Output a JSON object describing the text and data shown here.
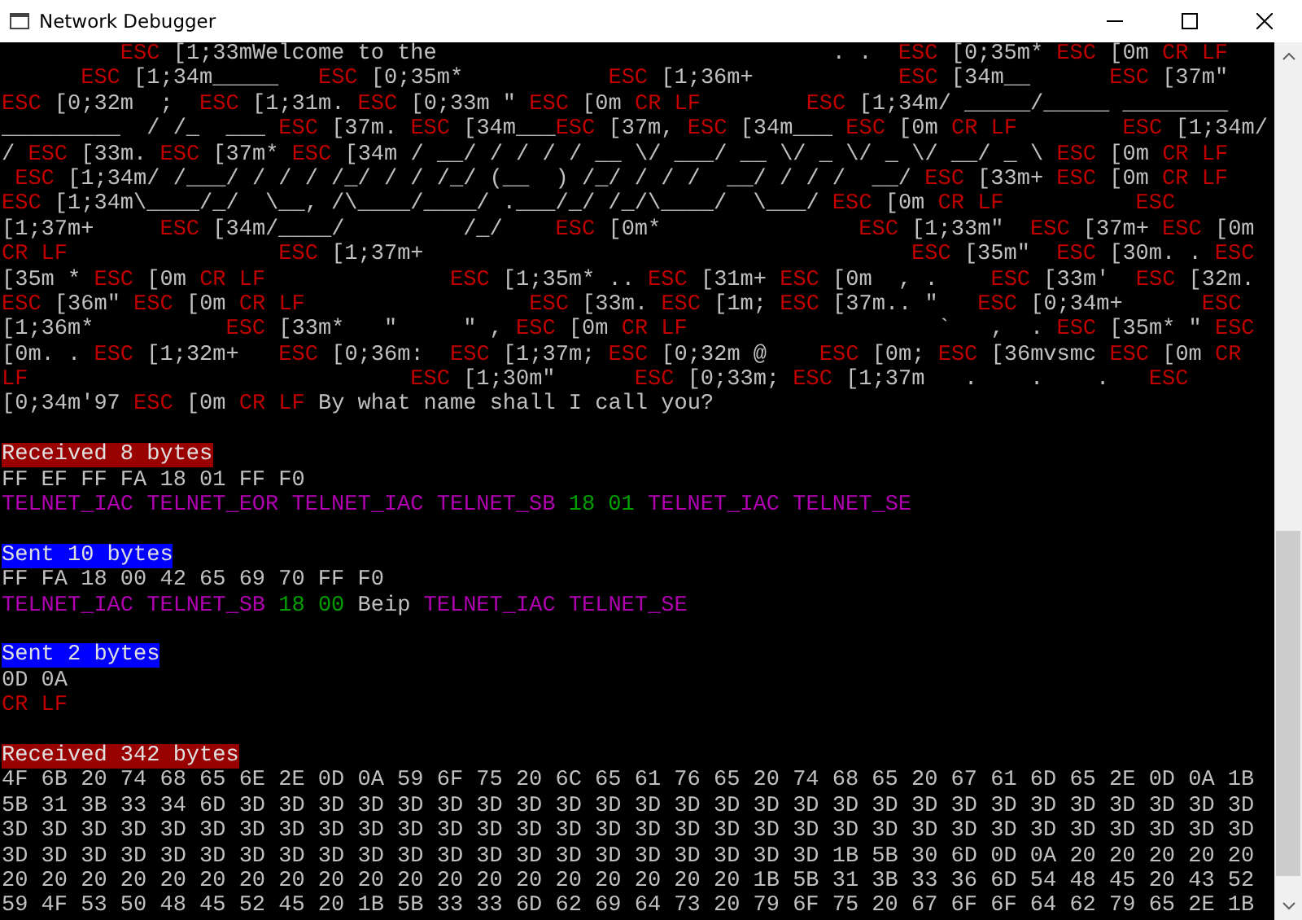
{
  "window": {
    "title": "Network Debugger"
  },
  "console": {
    "lines": [
      {
        "kind": "segments",
        "segments": [
          {
            "kind": "control",
            "text": "         ESC"
          },
          {
            "kind": "text",
            "text": " [1;33mWelcome to the                              . .  "
          },
          {
            "kind": "control",
            "text": "ESC"
          },
          {
            "kind": "text",
            "text": " [0;35m* "
          },
          {
            "kind": "control",
            "text": "ESC"
          },
          {
            "kind": "text",
            "text": " [0m "
          },
          {
            "kind": "control",
            "text": "CR LF"
          }
        ]
      },
      {
        "kind": "segments",
        "segments": [
          {
            "kind": "control",
            "text": "      ESC"
          },
          {
            "kind": "text",
            "text": " [1;34m_____   "
          },
          {
            "kind": "control",
            "text": "ESC"
          },
          {
            "kind": "text",
            "text": " [0;35m*           "
          },
          {
            "kind": "control",
            "text": "ESC"
          },
          {
            "kind": "text",
            "text": " [1;36m+           "
          },
          {
            "kind": "control",
            "text": "ESC"
          },
          {
            "kind": "text",
            "text": " [34m__      "
          },
          {
            "kind": "control",
            "text": "ESC"
          },
          {
            "kind": "text",
            "text": " [37m\""
          }
        ]
      },
      {
        "kind": "segments",
        "segments": [
          {
            "kind": "control",
            "text": "ESC"
          },
          {
            "kind": "text",
            "text": " [0;32m  ;  "
          },
          {
            "kind": "control",
            "text": "ESC"
          },
          {
            "kind": "text",
            "text": " [1;31m. "
          },
          {
            "kind": "control",
            "text": "ESC"
          },
          {
            "kind": "text",
            "text": " [0;33m \" "
          },
          {
            "kind": "control",
            "text": "ESC"
          },
          {
            "kind": "text",
            "text": " [0m "
          },
          {
            "kind": "control",
            "text": "CR LF"
          },
          {
            "kind": "control",
            "text": "        ESC"
          },
          {
            "kind": "text",
            "text": " [1;34m/ _____/_____ ________"
          }
        ]
      },
      {
        "kind": "segments",
        "segments": [
          {
            "kind": "text",
            "text": "_________  / /_  ___ "
          },
          {
            "kind": "control",
            "text": "ESC"
          },
          {
            "kind": "text",
            "text": " [37m. "
          },
          {
            "kind": "control",
            "text": "ESC"
          },
          {
            "kind": "text",
            "text": " [34m___"
          },
          {
            "kind": "control",
            "text": "ESC"
          },
          {
            "kind": "text",
            "text": " [37m, "
          },
          {
            "kind": "control",
            "text": "ESC"
          },
          {
            "kind": "text",
            "text": " [34m___ "
          },
          {
            "kind": "control",
            "text": "ESC"
          },
          {
            "kind": "text",
            "text": " [0m "
          },
          {
            "kind": "control",
            "text": "CR LF"
          },
          {
            "kind": "control",
            "text": "        ESC"
          },
          {
            "kind": "text",
            "text": " [1;34m/"
          }
        ]
      },
      {
        "kind": "segments",
        "segments": [
          {
            "kind": "text",
            "text": "/ "
          },
          {
            "kind": "control",
            "text": "ESC"
          },
          {
            "kind": "text",
            "text": " [33m. "
          },
          {
            "kind": "control",
            "text": "ESC"
          },
          {
            "kind": "text",
            "text": " [37m* "
          },
          {
            "kind": "control",
            "text": "ESC"
          },
          {
            "kind": "text",
            "text": " [34m / __/ / / / / __ \\/ ___/ __ \\/ _ \\/ _ \\/ __/ _ \\ "
          },
          {
            "kind": "control",
            "text": "ESC"
          },
          {
            "kind": "text",
            "text": " [0m "
          },
          {
            "kind": "control",
            "text": "CR LF"
          }
        ]
      },
      {
        "kind": "segments",
        "segments": [
          {
            "kind": "control",
            "text": " ESC"
          },
          {
            "kind": "text",
            "text": " [1;34m/ /___/ / / / /_/ / / /_/ (__  ) /_/ / / /  __/ / / /  __/ "
          },
          {
            "kind": "control",
            "text": "ESC"
          },
          {
            "kind": "text",
            "text": " [33m+ "
          },
          {
            "kind": "control",
            "text": "ESC"
          },
          {
            "kind": "text",
            "text": " [0m "
          },
          {
            "kind": "control",
            "text": "CR LF"
          }
        ]
      },
      {
        "kind": "segments",
        "segments": [
          {
            "kind": "control",
            "text": "ESC"
          },
          {
            "kind": "text",
            "text": " [1;34m\\____/_/  \\__, /\\____/____/ .___/_/ /_/\\____/  \\___/ "
          },
          {
            "kind": "control",
            "text": "ESC"
          },
          {
            "kind": "text",
            "text": " [0m "
          },
          {
            "kind": "control",
            "text": "CR LF"
          },
          {
            "kind": "control",
            "text": "          ESC"
          }
        ]
      },
      {
        "kind": "segments",
        "segments": [
          {
            "kind": "text",
            "text": "[1;37m+     "
          },
          {
            "kind": "control",
            "text": "ESC"
          },
          {
            "kind": "text",
            "text": " [34m/____/         /_/    "
          },
          {
            "kind": "control",
            "text": "ESC"
          },
          {
            "kind": "text",
            "text": " [0m*               "
          },
          {
            "kind": "control",
            "text": "ESC"
          },
          {
            "kind": "text",
            "text": " [1;33m\"  "
          },
          {
            "kind": "control",
            "text": "ESC"
          },
          {
            "kind": "text",
            "text": " [37m+ "
          },
          {
            "kind": "control",
            "text": "ESC"
          },
          {
            "kind": "text",
            "text": " [0m"
          }
        ]
      },
      {
        "kind": "segments",
        "segments": [
          {
            "kind": "control",
            "text": "CR LF"
          },
          {
            "kind": "control",
            "text": "                ESC"
          },
          {
            "kind": "text",
            "text": " [1;37m+                                     "
          },
          {
            "kind": "control",
            "text": "ESC"
          },
          {
            "kind": "text",
            "text": " [35m\"  "
          },
          {
            "kind": "control",
            "text": "ESC"
          },
          {
            "kind": "text",
            "text": " [30m. . "
          },
          {
            "kind": "control",
            "text": "ESC"
          }
        ]
      },
      {
        "kind": "segments",
        "segments": [
          {
            "kind": "text",
            "text": "[35m * "
          },
          {
            "kind": "control",
            "text": "ESC"
          },
          {
            "kind": "text",
            "text": " [0m "
          },
          {
            "kind": "control",
            "text": "CR LF"
          },
          {
            "kind": "control",
            "text": "              ESC"
          },
          {
            "kind": "text",
            "text": " [1;35m* .. "
          },
          {
            "kind": "control",
            "text": "ESC"
          },
          {
            "kind": "text",
            "text": " [31m+ "
          },
          {
            "kind": "control",
            "text": "ESC"
          },
          {
            "kind": "text",
            "text": " [0m  , .    "
          },
          {
            "kind": "control",
            "text": "ESC"
          },
          {
            "kind": "text",
            "text": " [33m'  "
          },
          {
            "kind": "control",
            "text": "ESC"
          },
          {
            "kind": "text",
            "text": " [32m."
          }
        ]
      },
      {
        "kind": "segments",
        "segments": [
          {
            "kind": "control",
            "text": "ESC"
          },
          {
            "kind": "text",
            "text": " [36m\" "
          },
          {
            "kind": "control",
            "text": "ESC"
          },
          {
            "kind": "text",
            "text": " [0m "
          },
          {
            "kind": "control",
            "text": "CR LF"
          },
          {
            "kind": "control",
            "text": "                 ESC"
          },
          {
            "kind": "text",
            "text": " [33m. "
          },
          {
            "kind": "control",
            "text": "ESC"
          },
          {
            "kind": "text",
            "text": " [1m; "
          },
          {
            "kind": "control",
            "text": "ESC"
          },
          {
            "kind": "text",
            "text": " [37m.. \"   "
          },
          {
            "kind": "control",
            "text": "ESC"
          },
          {
            "kind": "text",
            "text": " [0;34m+      "
          },
          {
            "kind": "control",
            "text": "ESC"
          }
        ]
      },
      {
        "kind": "segments",
        "segments": [
          {
            "kind": "text",
            "text": "[1;36m*          "
          },
          {
            "kind": "control",
            "text": "ESC"
          },
          {
            "kind": "text",
            "text": " [33m*   \"     \" , "
          },
          {
            "kind": "control",
            "text": "ESC"
          },
          {
            "kind": "text",
            "text": " [0m "
          },
          {
            "kind": "control",
            "text": "CR LF"
          },
          {
            "kind": "text",
            "text": "                   `   ,  . "
          },
          {
            "kind": "control",
            "text": "ESC"
          },
          {
            "kind": "text",
            "text": " [35m* \" "
          },
          {
            "kind": "control",
            "text": "ESC"
          }
        ]
      },
      {
        "kind": "segments",
        "segments": [
          {
            "kind": "text",
            "text": "[0m. . "
          },
          {
            "kind": "control",
            "text": "ESC"
          },
          {
            "kind": "text",
            "text": " [1;32m+   "
          },
          {
            "kind": "control",
            "text": "ESC"
          },
          {
            "kind": "text",
            "text": " [0;36m:  "
          },
          {
            "kind": "control",
            "text": "ESC"
          },
          {
            "kind": "text",
            "text": " [1;37m; "
          },
          {
            "kind": "control",
            "text": "ESC"
          },
          {
            "kind": "text",
            "text": " [0;32m @    "
          },
          {
            "kind": "control",
            "text": "ESC"
          },
          {
            "kind": "text",
            "text": " [0m; "
          },
          {
            "kind": "control",
            "text": "ESC"
          },
          {
            "kind": "text",
            "text": " [36mvsmc "
          },
          {
            "kind": "control",
            "text": "ESC"
          },
          {
            "kind": "text",
            "text": " [0m "
          },
          {
            "kind": "control",
            "text": "CR"
          }
        ]
      },
      {
        "kind": "segments",
        "segments": [
          {
            "kind": "control",
            "text": "LF"
          },
          {
            "kind": "control",
            "text": "                             ESC"
          },
          {
            "kind": "text",
            "text": " [1;30m\"      "
          },
          {
            "kind": "control",
            "text": "ESC"
          },
          {
            "kind": "text",
            "text": " [0;33m; "
          },
          {
            "kind": "control",
            "text": "ESC"
          },
          {
            "kind": "text",
            "text": " [1;37m   .    .    .   "
          },
          {
            "kind": "control",
            "text": "ESC"
          }
        ]
      },
      {
        "kind": "segments",
        "segments": [
          {
            "kind": "text",
            "text": "[0;34m'97 "
          },
          {
            "kind": "control",
            "text": "ESC"
          },
          {
            "kind": "text",
            "text": " [0m "
          },
          {
            "kind": "control",
            "text": "CR LF"
          },
          {
            "kind": "text",
            "text": " By what name shall I call you?"
          }
        ]
      },
      {
        "kind": "blank"
      },
      {
        "kind": "header",
        "color": "#990000",
        "text": "Received 8 bytes"
      },
      {
        "kind": "hex",
        "text": "FF EF FF FA 18 01 FF F0"
      },
      {
        "kind": "segments",
        "segments": [
          {
            "kind": "telnet",
            "text": "TELNET_IAC TELNET_EOR TELNET_IAC TELNET_SB"
          },
          {
            "kind": "value",
            "text": " 18 01"
          },
          {
            "kind": "telnet",
            "text": " TELNET_IAC TELNET_SE"
          }
        ]
      },
      {
        "kind": "blank"
      },
      {
        "kind": "header",
        "color": "#0000ff",
        "text": "Sent 10 bytes"
      },
      {
        "kind": "hex",
        "text": "FF FA 18 00 42 65 69 70 FF F0"
      },
      {
        "kind": "segments",
        "segments": [
          {
            "kind": "telnet",
            "text": "TELNET_IAC TELNET_SB"
          },
          {
            "kind": "value",
            "text": " 18 00"
          },
          {
            "kind": "text",
            "text": " Beip"
          },
          {
            "kind": "telnet",
            "text": " TELNET_IAC TELNET_SE"
          }
        ]
      },
      {
        "kind": "blank"
      },
      {
        "kind": "header",
        "color": "#0000ff",
        "text": "Sent 2 bytes"
      },
      {
        "kind": "hex",
        "text": "0D 0A"
      },
      {
        "kind": "segments",
        "segments": [
          {
            "kind": "control",
            "text": "CR LF"
          }
        ]
      },
      {
        "kind": "blank"
      },
      {
        "kind": "header",
        "color": "#990000",
        "text": "Received 342 bytes"
      },
      {
        "kind": "hex",
        "text": "4F 6B 20 74 68 65 6E 2E 0D 0A 59 6F 75 20 6C 65 61 76 65 20 74 68 65 20 67 61 6D 65 2E 0D 0A 1B"
      },
      {
        "kind": "hex",
        "text": "5B 31 3B 33 34 6D 3D 3D 3D 3D 3D 3D 3D 3D 3D 3D 3D 3D 3D 3D 3D 3D 3D 3D 3D 3D 3D 3D 3D 3D 3D 3D"
      },
      {
        "kind": "hex",
        "text": "3D 3D 3D 3D 3D 3D 3D 3D 3D 3D 3D 3D 3D 3D 3D 3D 3D 3D 3D 3D 3D 3D 3D 3D 3D 3D 3D 3D 3D 3D 3D 3D"
      },
      {
        "kind": "hex",
        "text": "3D 3D 3D 3D 3D 3D 3D 3D 3D 3D 3D 3D 3D 3D 3D 3D 3D 3D 3D 3D 3D 1B 5B 30 6D 0D 0A 20 20 20 20 20"
      },
      {
        "kind": "hex",
        "text": "20 20 20 20 20 20 20 20 20 20 20 20 20 20 20 20 20 20 20 1B 5B 31 3B 33 36 6D 54 48 45 20 43 52"
      },
      {
        "kind": "hex",
        "text": "59 4F 53 50 48 45 52 45 20 1B 5B 33 33 6D 62 69 64 73 20 79 6F 75 20 67 6F 6F 64 62 79 65 2E 1B"
      }
    ]
  }
}
